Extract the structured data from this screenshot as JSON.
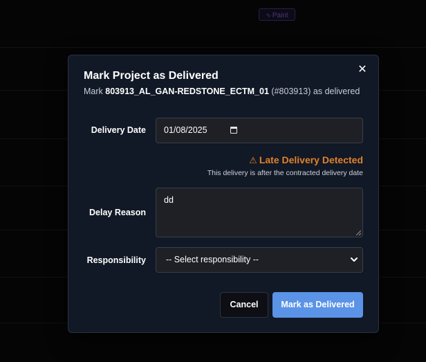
{
  "background": {
    "badge_label": "Paint",
    "badge_icon": "trend-icon"
  },
  "modal": {
    "title": "Mark Project as Delivered",
    "subtitle_prefix": "Mark",
    "project_name": "803913_AL_GAN-REDSTONE_ECTM_01",
    "project_id": "(#803913)",
    "subtitle_suffix": "as delivered",
    "close_icon": "close-icon"
  },
  "form": {
    "delivery_date_label": "Delivery Date",
    "delivery_date_value": "01/08/2025",
    "warning_title": "Late Delivery Detected",
    "warning_text": "This delivery is after the contracted delivery date",
    "delay_reason_label": "Delay Reason",
    "delay_reason_value": "dd",
    "responsibility_label": "Responsibility",
    "responsibility_selected": "-- Select responsibility --"
  },
  "actions": {
    "cancel_label": "Cancel",
    "submit_label": "Mark as Delivered"
  },
  "colors": {
    "modal_bg": "#111826",
    "warning": "#e0822a",
    "primary": "#5b93e6"
  }
}
